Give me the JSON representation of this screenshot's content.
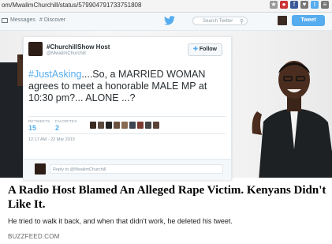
{
  "browser": {
    "url": "om/MwalimChurchill/status/579904791733751808"
  },
  "twitter_nav": {
    "messages_label": "Messages",
    "discover_label": "# Discover",
    "search_placeholder": "Search Twitter",
    "tweet_button_label": "Tweet"
  },
  "tweet": {
    "display_name": "#ChurchillShow Host",
    "handle": "@MwalimChurchill",
    "follow_label": "Follow",
    "hashtag": "#JustAsking",
    "body": "....So, a MARRIED WOMAN agrees to meet a honorable MALE MP at 10:30 pm?... ALONE ...?",
    "retweets_label": "RETWEETS",
    "retweets_count": "15",
    "favorites_label": "FAVORITES",
    "favorites_count": "2",
    "timestamp": "12:17 AM - 22 Mar 2015",
    "reply_placeholder": "Reply to @MwalimChurchill"
  },
  "article": {
    "headline": "A Radio Host Blamed An Alleged Rape Victim. Kenyans Didn't Like It.",
    "dek": "He tried to walk it back, and when that didn't work, he deleted his tweet.",
    "source": "BUZZFEED.COM"
  },
  "colors": {
    "twitter_blue": "#55acee",
    "text_dark": "#292f33",
    "muted": "#8899a6"
  }
}
